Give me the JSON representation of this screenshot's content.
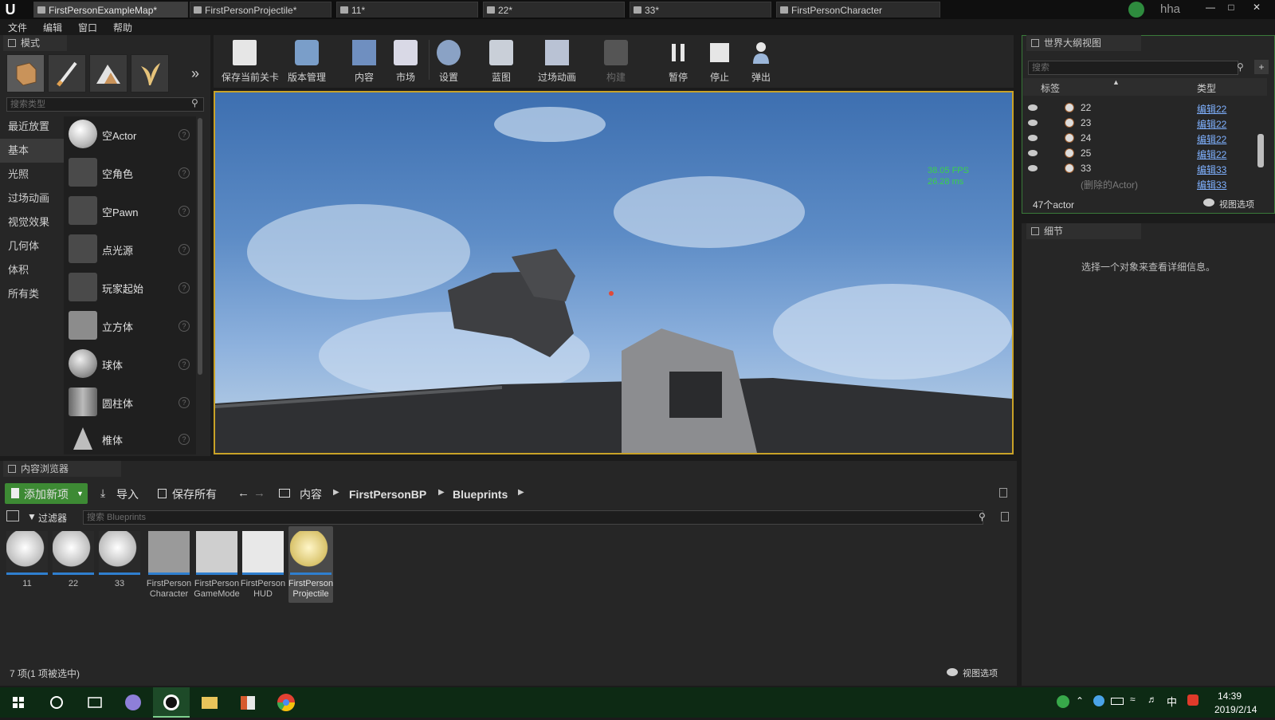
{
  "titlebar": {
    "logo": "U",
    "tabs": [
      "FirstPersonExampleMap*",
      "FirstPersonProjectile*",
      "11*",
      "22*",
      "33*",
      "FirstPersonCharacter"
    ],
    "user": "hha"
  },
  "menu": [
    "文件",
    "编辑",
    "窗口",
    "帮助"
  ],
  "modes": {
    "title": "模式",
    "search_placeholder": "搜索类型",
    "categories": [
      "最近放置",
      "基本",
      "光照",
      "过场动画",
      "视觉效果",
      "几何体",
      "体积",
      "所有类"
    ],
    "items": [
      "空Actor",
      "空角色",
      "空Pawn",
      "点光源",
      "玩家起始",
      "立方体",
      "球体",
      "圆柱体",
      "椎体"
    ],
    "help_glyph": "?"
  },
  "toolbar": {
    "buttons": [
      "保存当前关卡",
      "版本管理",
      "内容",
      "市场",
      "设置",
      "蓝图",
      "过场动画",
      "构建",
      "暂停",
      "停止",
      "弹出"
    ],
    "overflow": "»"
  },
  "viewport": {
    "fps": "38.05 FPS",
    "ms": "26.28 ms"
  },
  "outliner": {
    "title": "世界大纲视图",
    "search_placeholder": "搜索",
    "col_label": "标签",
    "col_type": "类型",
    "rows": [
      {
        "name": "22",
        "type": "编辑22"
      },
      {
        "name": "23",
        "type": "编辑22"
      },
      {
        "name": "24",
        "type": "编辑22"
      },
      {
        "name": "25",
        "type": "编辑22"
      },
      {
        "name": "33",
        "type": "编辑33"
      },
      {
        "name": "(删除的Actor)",
        "type": "编辑33"
      }
    ],
    "count": "47个actor",
    "view_options": "视图选项"
  },
  "details": {
    "title": "细节",
    "empty_msg": "选择一个对象来查看详细信息。"
  },
  "content_browser": {
    "title": "内容浏览器",
    "add_new": "添加新项",
    "import": "导入",
    "save_all": "保存所有",
    "path": [
      "内容",
      "FirstPersonBP",
      "Blueprints"
    ],
    "filters": "过滤器",
    "search_placeholder": "搜索 Blueprints",
    "assets": [
      {
        "name": "11"
      },
      {
        "name": "22"
      },
      {
        "name": "33"
      },
      {
        "name": "FirstPerson Character"
      },
      {
        "name": "FirstPerson GameMode"
      },
      {
        "name": "FirstPerson HUD"
      },
      {
        "name": "FirstPerson Projectile"
      }
    ],
    "status": "7 项(1 项被选中)",
    "view_options": "视图选项"
  },
  "taskbar": {
    "time": "14:39",
    "date": "2019/2/14",
    "ime": "中"
  }
}
